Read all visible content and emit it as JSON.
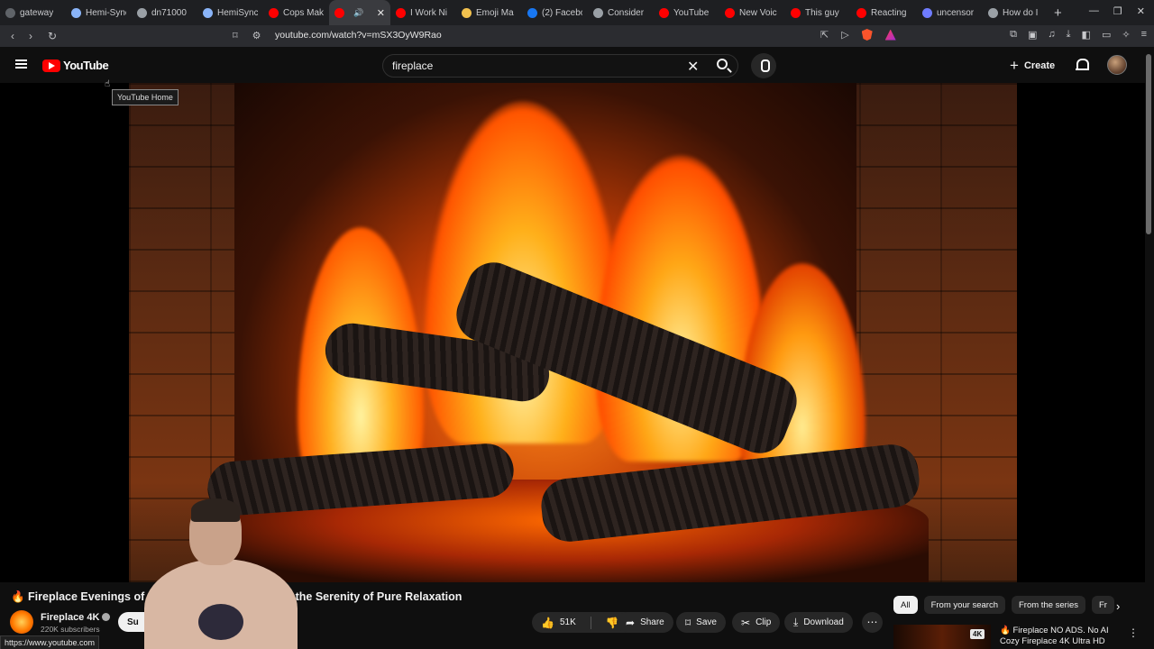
{
  "browser": {
    "tabs": [
      {
        "title": "gateway",
        "color": "#5f6368"
      },
      {
        "title": "Hemi-Sync",
        "color": "#8ab4f8"
      },
      {
        "title": "dn71000",
        "color": "#9aa0a6"
      },
      {
        "title": "HemiSync",
        "color": "#8ab4f8"
      },
      {
        "title": "Cops Mak",
        "color": "#ff0000"
      },
      {
        "title": "",
        "color": "#ff0000",
        "active": true
      },
      {
        "title": "I Work Ni",
        "color": "#ff0000"
      },
      {
        "title": "Emoji Ma",
        "color": "#f2c14e"
      },
      {
        "title": "(2) Facebo",
        "color": "#1877f2"
      },
      {
        "title": "Consider",
        "color": "#9aa0a6"
      },
      {
        "title": "YouTube",
        "color": "#ff0000"
      },
      {
        "title": "New Voic",
        "color": "#ff0000"
      },
      {
        "title": "This guy",
        "color": "#ff0000"
      },
      {
        "title": "Reacting",
        "color": "#ff0000"
      },
      {
        "title": "uncensor",
        "color": "#6f7cff"
      },
      {
        "title": "How do I",
        "color": "#9aa0a6"
      }
    ],
    "url": "youtube.com/watch?v=mSX3OyW9Rao",
    "status_url": "https://www.youtube.com"
  },
  "header": {
    "logo_text": "YouTube",
    "search_value": "fireplace",
    "create_label": "Create",
    "tooltip": "YouTube Home"
  },
  "video": {
    "title": "🔥 Fireplace Evenings of C… Crackling Sounds, and the Serenity of Pure Relaxation",
    "channel": "Fireplace 4K",
    "subscribers": "220K subscribers",
    "subscribe_label": "Su",
    "likes": "51K",
    "share_label": "Share",
    "save_label": "Save",
    "clip_label": "Clip",
    "download_label": "Download"
  },
  "sidebar": {
    "chips": [
      "All",
      "From your search",
      "From the series",
      "Fr"
    ],
    "recommended": {
      "title": "🔥 Fireplace NO ADS. No AI Cozy Fireplace 4K Ultra HD",
      "badge": "4K"
    }
  }
}
